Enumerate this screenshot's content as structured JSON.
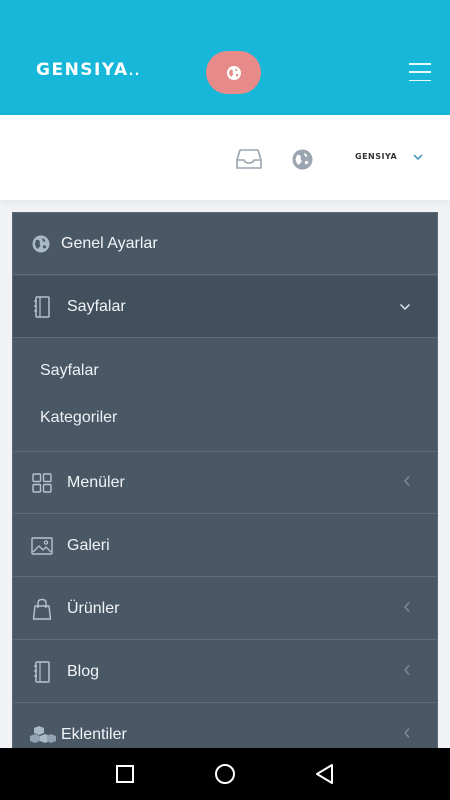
{
  "header": {
    "logo_text": "GENSIYA",
    "logo_dots": "..",
    "globe_icon": "globe-icon",
    "menu_icon": "hamburger-icon"
  },
  "subheader": {
    "inbox_icon": "inbox-icon",
    "globe_icon": "globe-icon",
    "user_logo_text": "GENSIYA",
    "dropdown_icon": "chevron-down-icon"
  },
  "sidebar": {
    "items": [
      {
        "label": "Genel Ayarlar",
        "icon": "globe-icon"
      },
      {
        "label": "Sayfalar",
        "icon": "notebook-icon",
        "expanded": true,
        "children": [
          {
            "label": "Sayfalar"
          },
          {
            "label": "Kategoriler"
          }
        ]
      },
      {
        "label": "Menüler",
        "icon": "grid-icon"
      },
      {
        "label": "Galeri",
        "icon": "image-icon"
      },
      {
        "label": "Ürünler",
        "icon": "shopping-bag-icon"
      },
      {
        "label": "Blog",
        "icon": "notebook-icon"
      },
      {
        "label": "Eklentiler",
        "icon": "cubes-icon"
      }
    ]
  },
  "colors": {
    "topbar": "#16b7d8",
    "pill": "#e68a8a",
    "sidebar": "#4a5866",
    "sidebar_active": "#424f5c"
  },
  "system_nav": {
    "recents_icon": "square-icon",
    "home_icon": "circle-icon",
    "back_icon": "triangle-back-icon"
  }
}
